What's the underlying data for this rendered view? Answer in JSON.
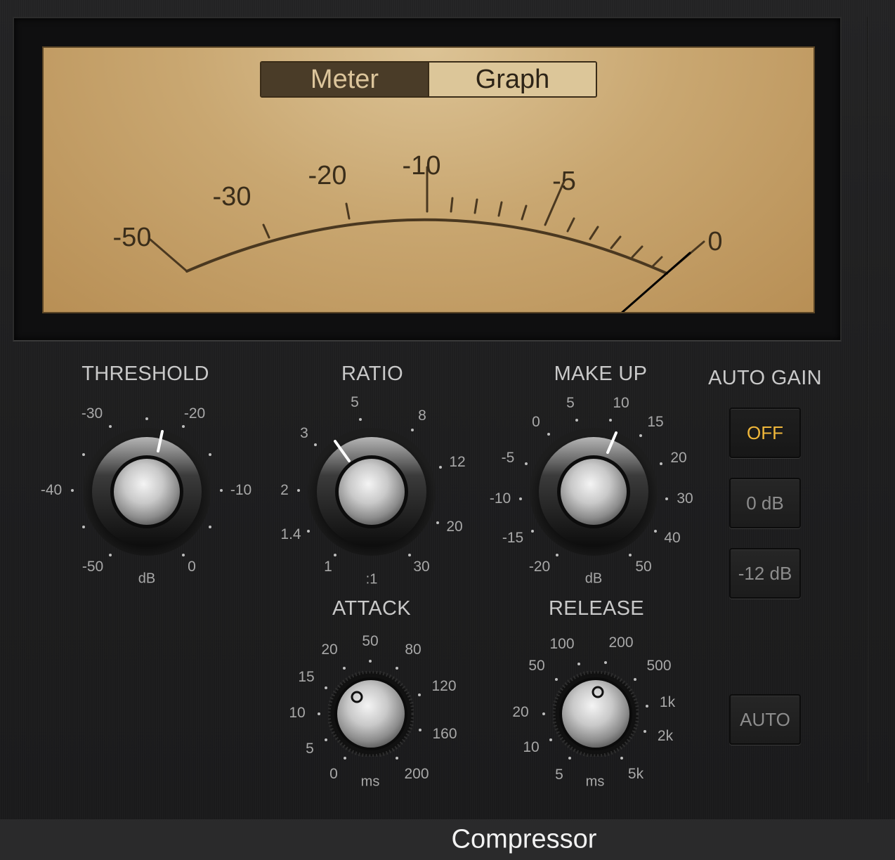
{
  "window": {
    "title": "Compressor"
  },
  "meter": {
    "tabs": [
      {
        "label": "Meter",
        "active": true
      },
      {
        "label": "Graph",
        "active": false
      }
    ],
    "scale_labels": [
      "-50",
      "-30",
      "-20",
      "-10",
      "-5",
      "0"
    ]
  },
  "knobs": {
    "threshold": {
      "label": "THRESHOLD",
      "unit": "dB",
      "scale": [
        "-30",
        "-20",
        "-40",
        "-10",
        "-50",
        "0"
      ]
    },
    "ratio": {
      "label": "RATIO",
      "unit": ":1",
      "scale": [
        "5",
        "8",
        "3",
        "12",
        "2",
        "1.4",
        "20",
        "1",
        "30"
      ]
    },
    "makeup": {
      "label": "MAKE UP",
      "unit": "dB",
      "scale": [
        "5",
        "10",
        "0",
        "15",
        "-5",
        "20",
        "-10",
        "30",
        "-15",
        "40",
        "-20",
        "50"
      ]
    },
    "attack": {
      "label": "ATTACK",
      "unit": "ms",
      "scale": [
        "50",
        "20",
        "80",
        "15",
        "120",
        "10",
        "160",
        "5",
        "0",
        "200"
      ]
    },
    "release": {
      "label": "RELEASE",
      "unit": "ms",
      "scale": [
        "100",
        "200",
        "50",
        "500",
        "1k",
        "20",
        "2k",
        "10",
        "5",
        "5k"
      ]
    }
  },
  "auto_gain": {
    "label": "AUTO GAIN",
    "buttons": [
      {
        "label": "OFF",
        "selected": true
      },
      {
        "label": "0 dB",
        "selected": false
      },
      {
        "label": "-12 dB",
        "selected": false
      }
    ],
    "auto_label": "AUTO"
  },
  "colors": {
    "accent_selected": "#f0b73a",
    "meter_face": "#c9a771",
    "meter_ink": "#4a3820"
  }
}
